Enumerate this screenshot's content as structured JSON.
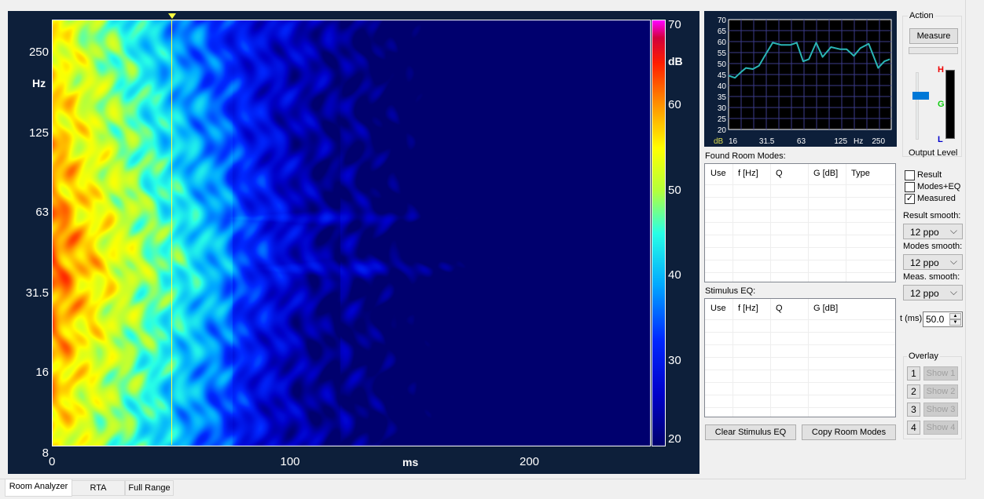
{
  "spectrogram": {
    "y_axis": {
      "unit": "Hz",
      "ticks": [
        "250",
        "125",
        "63",
        "31.5",
        "16",
        "8"
      ],
      "scale": "log",
      "range": [
        8,
        307
      ]
    },
    "x_axis": {
      "unit": "ms",
      "ticks": [
        "0",
        "100",
        "200"
      ],
      "range": [
        0,
        249
      ]
    },
    "colorbar": {
      "unit": "dB",
      "ticks": [
        "70",
        "60",
        "50",
        "40",
        "30",
        "20"
      ],
      "range": [
        20,
        70
      ]
    },
    "cursor_ms": 50
  },
  "mini_chart": {
    "y_ticks": [
      "70",
      "65",
      "60",
      "55",
      "50",
      "45",
      "40",
      "35",
      "30",
      "25",
      "20"
    ],
    "x_ticks": [
      "16",
      "31.5",
      "63",
      "125",
      "250"
    ],
    "x_unit": "Hz",
    "y_unit": "dB",
    "line_color": "#2ab5b5",
    "points": [
      [
        16,
        44.5
      ],
      [
        18,
        43.5
      ],
      [
        20,
        46
      ],
      [
        22,
        48
      ],
      [
        25,
        47.5
      ],
      [
        28,
        49
      ],
      [
        31.5,
        54
      ],
      [
        36,
        59.5
      ],
      [
        42,
        58.5
      ],
      [
        50,
        58.5
      ],
      [
        56,
        59.5
      ],
      [
        63,
        51
      ],
      [
        70,
        52
      ],
      [
        80,
        59.5
      ],
      [
        90,
        53
      ],
      [
        105,
        57.5
      ],
      [
        125,
        56.5
      ],
      [
        140,
        56.5
      ],
      [
        160,
        53.5
      ],
      [
        180,
        57
      ],
      [
        210,
        59
      ],
      [
        250,
        48
      ],
      [
        280,
        51
      ],
      [
        310,
        52
      ]
    ]
  },
  "action": {
    "title": "Action",
    "measure": "Measure",
    "output_level": "Output Level",
    "h": "H",
    "g": "G",
    "l": "L"
  },
  "room_modes": {
    "title": "Found Room Modes:",
    "columns": [
      "Use",
      "f [Hz]",
      "Q",
      "G [dB]",
      "Type"
    ]
  },
  "stimulus_eq": {
    "title": "Stimulus EQ:",
    "columns": [
      "Use",
      "f [Hz]",
      "Q",
      "G [dB]"
    ]
  },
  "checkboxes": [
    {
      "label": "Result",
      "checked": false
    },
    {
      "label": "Modes+EQ",
      "checked": false
    },
    {
      "label": "Measured",
      "checked": true
    }
  ],
  "smoothing": [
    {
      "label": "Result smooth:",
      "value": "12 ppo"
    },
    {
      "label": "Modes smooth:",
      "value": "12 ppo"
    },
    {
      "label": "Meas. smooth:",
      "value": "12 ppo"
    }
  ],
  "t_ms": {
    "label": "t (ms)",
    "value": "50.0"
  },
  "overlay": {
    "title": "Overlay",
    "items": [
      {
        "num": "1",
        "show": "Show 1"
      },
      {
        "num": "2",
        "show": "Show 2"
      },
      {
        "num": "3",
        "show": "Show 3"
      },
      {
        "num": "4",
        "show": "Show 4"
      }
    ]
  },
  "buttons": {
    "clear_eq": "Clear Stimulus EQ",
    "copy_modes": "Copy Room Modes"
  },
  "tabs": [
    "Room Analyzer",
    "RTA",
    "Full Range"
  ]
}
